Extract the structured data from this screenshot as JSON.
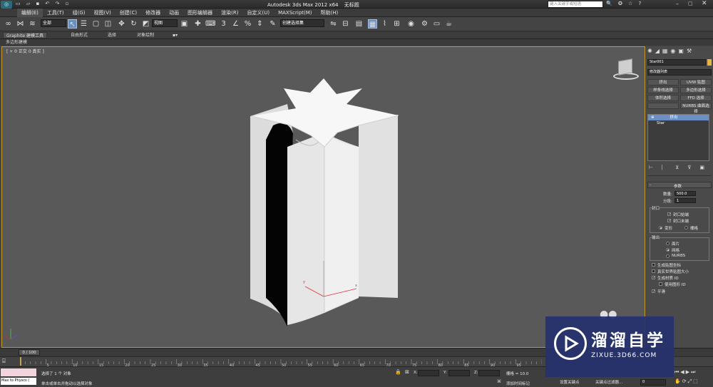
{
  "window": {
    "title": "Autodesk 3ds Max  2012 x64",
    "doc_title": "无标题",
    "search_placeholder": "键入关键字或短语"
  },
  "menus": [
    "编辑(E)",
    "工具(T)",
    "组(G)",
    "视图(V)",
    "创建(C)",
    "修改器",
    "动画",
    "图形编辑器",
    "渲染(R)",
    "自定义(U)",
    "MAXScript(M)",
    "帮助(H)"
  ],
  "toolbar": {
    "selection_filter": "全部",
    "coord_system": "视图",
    "named_selection": "创建选择集"
  },
  "ribbon": {
    "tabs": [
      "Graphite 建模工具",
      "自由形式",
      "选择",
      "对象绘制"
    ],
    "sub_label": "多边形建模"
  },
  "viewport": {
    "label": "[ + 0 正交 0 真实 ]"
  },
  "command_panel": {
    "object_name": "Star001",
    "modifier_list": "修改器列表",
    "modifier_buttons": [
      "挤出",
      "UVW 贴图",
      "样条线选择",
      "多边形选择",
      "体积选择",
      "FFD 选择",
      "",
      "NURBS 曲面选择"
    ],
    "stack": [
      {
        "label": "挤出",
        "selected": true
      },
      {
        "label": "Star",
        "selected": false
      }
    ],
    "params": {
      "rollout_title": "参数",
      "amount_label": "数量:",
      "amount_value": "500.0",
      "segments_label": "分段:",
      "segments_value": "1",
      "capping_title": "封口",
      "cap_start": "封口始端",
      "cap_end": "封口末端",
      "morph": "变形",
      "grid": "栅格",
      "output_title": "输出",
      "out_patch": "面片",
      "out_mesh": "网格",
      "out_nurbs": "NURBS",
      "gen_map_coords": "生成贴图坐标",
      "real_world_map": "真实世界贴图大小",
      "gen_mat_ids": "生成材质 ID",
      "use_shape_ids": "使用图形 ID",
      "smooth": "平滑"
    }
  },
  "timeline": {
    "frame_counter": "0 / 100",
    "ticks": [
      "0",
      "5",
      "10",
      "15",
      "20",
      "25",
      "30",
      "35",
      "40",
      "45",
      "50",
      "55",
      "60",
      "65",
      "70",
      "75",
      "80",
      "85",
      "90",
      "95",
      "100"
    ]
  },
  "status": {
    "script_listener": "Max to Physcs (",
    "selection_text": "选择了 1 个 对象",
    "prompt_text": "单击或单击并拖动以选择对象",
    "x_label": "X:",
    "y_label": "Y:",
    "z_label": "Z:",
    "grid_text": "栅格 = 10.0",
    "add_time_tag": "添加时间标记",
    "auto_key": "设置关键点",
    "key_filters": "关键点过滤器...",
    "frame": "0"
  },
  "watermark": {
    "title": "溜溜自学",
    "url": "ZIXUE.3D66.COM"
  },
  "colors": {
    "viewport_bg": "#595959",
    "active_border": "#c59a2a",
    "watermark_bg": "#26326e"
  }
}
